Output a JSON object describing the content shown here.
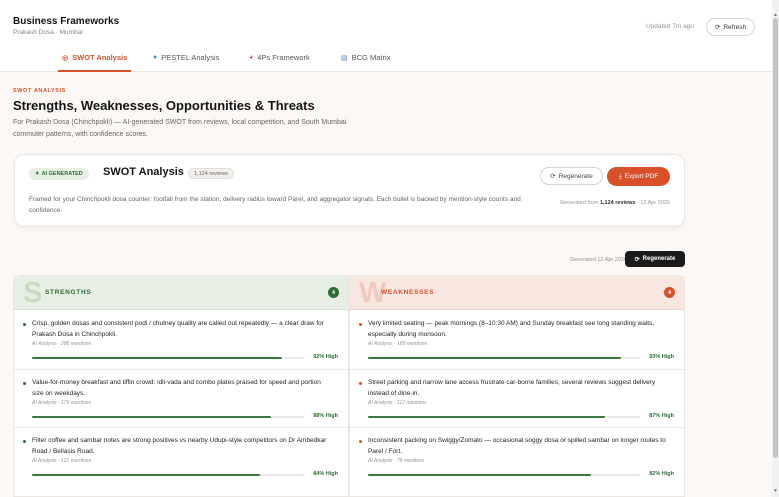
{
  "app": {
    "title": "Business Frameworks",
    "subtitle": "Prakash Dosa · Mumbai",
    "updated": "Updated 7m ago",
    "refresh_label": "Refresh"
  },
  "tabs": [
    {
      "label": "SWOT Analysis",
      "icon": "target-icon",
      "active": true
    },
    {
      "label": "PESTEL Analysis",
      "icon": "globe-icon",
      "active": false
    },
    {
      "label": "4Ps Framework",
      "icon": "palette-icon",
      "active": false
    },
    {
      "label": "BCG Matrix",
      "icon": "bar-chart-icon",
      "active": false
    }
  ],
  "section": {
    "kicker": "SWOT ANALYSIS",
    "title": "Strengths, Weaknesses, Opportunities & Threats",
    "description": "For Prakash Dosa (Chinchpokli) — AI-generated SWOT from reviews, local competition, and South Mumbai commuter patterns, with confidence scores."
  },
  "card": {
    "badge": "AI GENERATED",
    "title": "SWOT Analysis",
    "reviews_pill": "1,124 reviews",
    "description": "Framed for your Chinchpokli dosa counter: footfall from the station, delivery radius toward Parel, and aggregator signals. Each bullet is backed by mention-style counts and confidence.",
    "regenerate_label": "Regenerate",
    "export_label": "Export PDF",
    "generated_prefix": "Generated from ",
    "generated_reviews": "1,124 reviews",
    "generated_suffix": " · 12 Apr 2026"
  },
  "generated": {
    "label": "Generated 12 Apr 2026",
    "regenerate_label": "Regenerate"
  },
  "quadrants": {
    "strengths": {
      "letter": "S",
      "label": "STRENGTHS",
      "count": "4",
      "items": [
        {
          "text": "Crisp, golden dosas and consistent podi / chutney quality are called out repeatedly — a clear draw for Prakash Dosa in Chinchpokli.",
          "meta": "AI Analysis · 288 mentions",
          "confidence": 0.92,
          "confidence_label": "92% High"
        },
        {
          "text": "Value-for-money breakfast and tiffin crowd: idli-vada and combo plates praised for speed and portion size on weekdays.",
          "meta": "AI Analysis · 176 mentions",
          "confidence": 0.88,
          "confidence_label": "88% High"
        },
        {
          "text": "Filter coffee and sambar notes are strong positives vs nearby Udupi-style competitors on Dr Ambedkar Road / Bellasis Road.",
          "meta": "AI Analysis · 121 mentions",
          "confidence": 0.84,
          "confidence_label": "84% High"
        }
      ]
    },
    "weaknesses": {
      "letter": "W",
      "label": "WEAKNESSES",
      "count": "4",
      "items": [
        {
          "text": "Very limited seating — peak mornings (8–10:30 AM) and Sunday breakfast see long standing waits, especially during monsoon.",
          "meta": "AI Analysis · 189 mentions",
          "confidence": 0.93,
          "confidence_label": "93% High"
        },
        {
          "text": "Street parking and narrow lane access frustrate car-borne families; several reviews suggest delivery instead of dine-in.",
          "meta": "AI Analysis · 112 mentions",
          "confidence": 0.87,
          "confidence_label": "87% High"
        },
        {
          "text": "Inconsistent packing on Swiggy/Zomato — occasional soggy dosa or spilled sambar on longer routes to Parel / Fort.",
          "meta": "AI Analysis · 78 mentions",
          "confidence": 0.82,
          "confidence_label": "82% High"
        }
      ]
    }
  },
  "colors": {
    "accent": "#d8502a",
    "strength": "#2f6b34",
    "weakness": "#d8502a"
  }
}
